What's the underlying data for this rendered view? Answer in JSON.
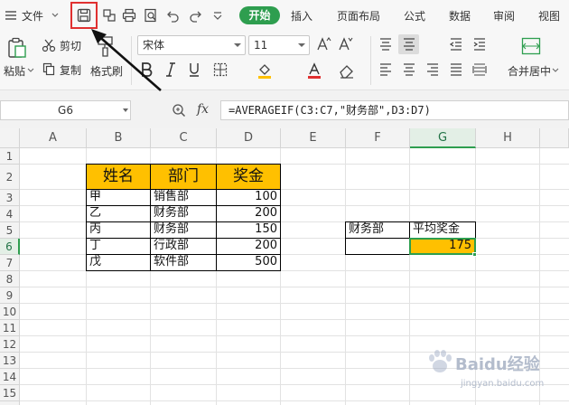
{
  "menubar": {
    "file_label": "文件",
    "tabs": [
      {
        "label": "开始",
        "active": true
      },
      {
        "label": "插入"
      },
      {
        "label": "页面布局"
      },
      {
        "label": "公式"
      },
      {
        "label": "数据"
      },
      {
        "label": "审阅"
      },
      {
        "label": "视图"
      }
    ]
  },
  "ribbon": {
    "paste_label": "粘贴",
    "cut_label": "剪切",
    "copy_label": "复制",
    "format_painter_label": "格式刷",
    "font_name": "宋体",
    "font_size": "11",
    "merge_label": "合并居中"
  },
  "formula_bar": {
    "name_box": "G6",
    "fx_label": "fx",
    "formula": "=AVERAGEIF(C3:C7,\"财务部\",D3:D7)"
  },
  "sheet": {
    "columns": [
      "A",
      "B",
      "C",
      "D",
      "E",
      "F",
      "G",
      "H"
    ],
    "rows": [
      "1",
      "2",
      "3",
      "4",
      "5",
      "6",
      "7",
      "8",
      "9",
      "10",
      "11",
      "12",
      "13",
      "14",
      "15",
      "16"
    ],
    "table_header": [
      "姓名",
      "部门",
      "奖金"
    ],
    "table_rows": [
      {
        "name": "甲",
        "dept": "销售部",
        "bonus": "100"
      },
      {
        "name": "乙",
        "dept": "财务部",
        "bonus": "200"
      },
      {
        "name": "丙",
        "dept": "财务部",
        "bonus": "150"
      },
      {
        "name": "丁",
        "dept": "行政部",
        "bonus": "200"
      },
      {
        "name": "戊",
        "dept": "软件部",
        "bonus": "500"
      }
    ],
    "criteria_label": "财务部",
    "avg_label": "平均奖金",
    "avg_value": "175"
  },
  "watermark": {
    "text": "Baidu经验",
    "sub": "jingyan.baidu.com"
  },
  "colors": {
    "accent_green": "#2e9e4f",
    "header_fill": "#ffc000",
    "highlight_red": "#e03030"
  }
}
